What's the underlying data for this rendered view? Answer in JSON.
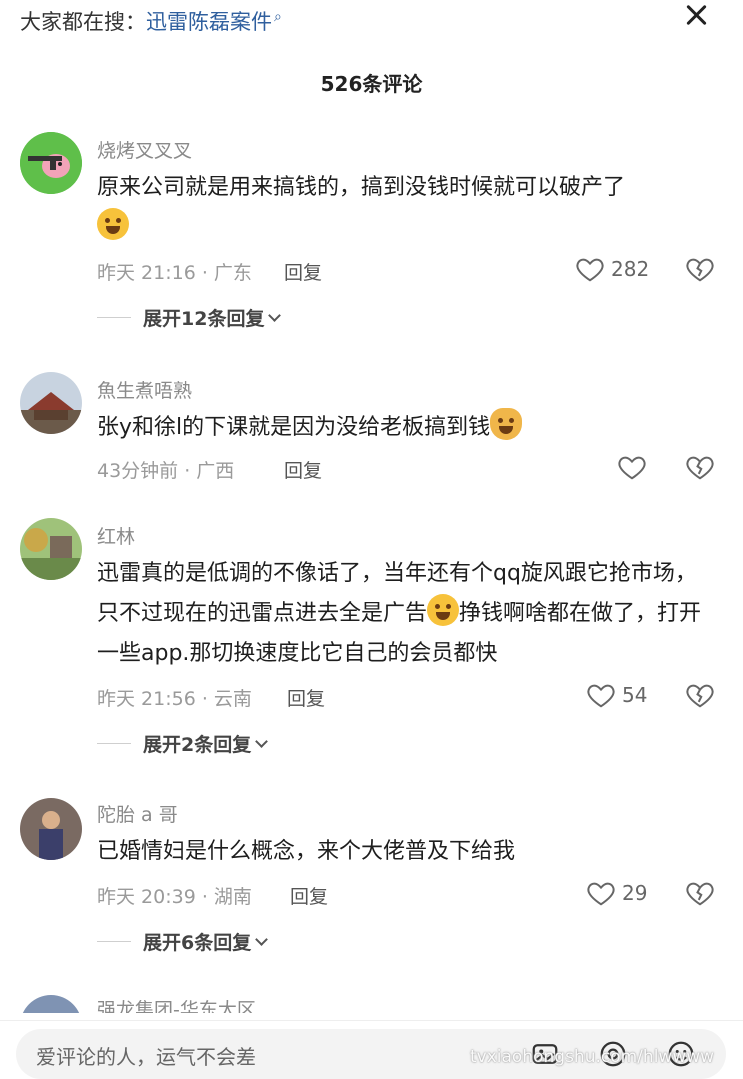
{
  "header": {
    "search_prefix": "大家都在搜：",
    "search_keyword": "迅雷陈磊案件",
    "search_icon": "search-icon",
    "comment_count": "526条评论"
  },
  "comments": [
    {
      "user": "烧烤叉叉叉",
      "text": "原来公司就是用来搞钱的，搞到没钱时候就可以破产了",
      "time_location": "昨天 21:16 · 广东",
      "reply": "回复",
      "likes": "282",
      "expand": "展开12条回复"
    },
    {
      "user": "魚生煮唔熟",
      "text": "张y和徐l的下课就是因为没给老板搞到钱",
      "time_location": "43分钟前 · 广西",
      "reply": "回复",
      "likes": ""
    },
    {
      "user": "红林",
      "text_part1": "迅雷真的是低调的不像话了，当年还有个qq旋风跟它抢市场，只不过现在的迅雷点进去全是广告",
      "text_part2": "挣钱啊啥都在做了，打开一些app.那切换速度比它自己的会员都快",
      "time_location": "昨天 21:56 · 云南",
      "reply": "回复",
      "likes": "54",
      "expand": "展开2条回复"
    },
    {
      "user": "陀胎 a 哥",
      "text": "已婚情妇是什么概念，来个大佬普及下给我",
      "time_location": "昨天 20:39 · 湖南",
      "reply": "回复",
      "likes": "29",
      "expand": "展开6条回复"
    }
  ],
  "next_comment": {
    "user": "强龙集团-华东大区"
  },
  "input_bar": {
    "placeholder": "爱评论的人，运气不会差",
    "watermark": "tvxiaohongshu.com/hlwwww"
  },
  "colors": {
    "keyword": "#2f5f9e",
    "meta": "#9a9a9a",
    "text": "#1e1e1e"
  }
}
